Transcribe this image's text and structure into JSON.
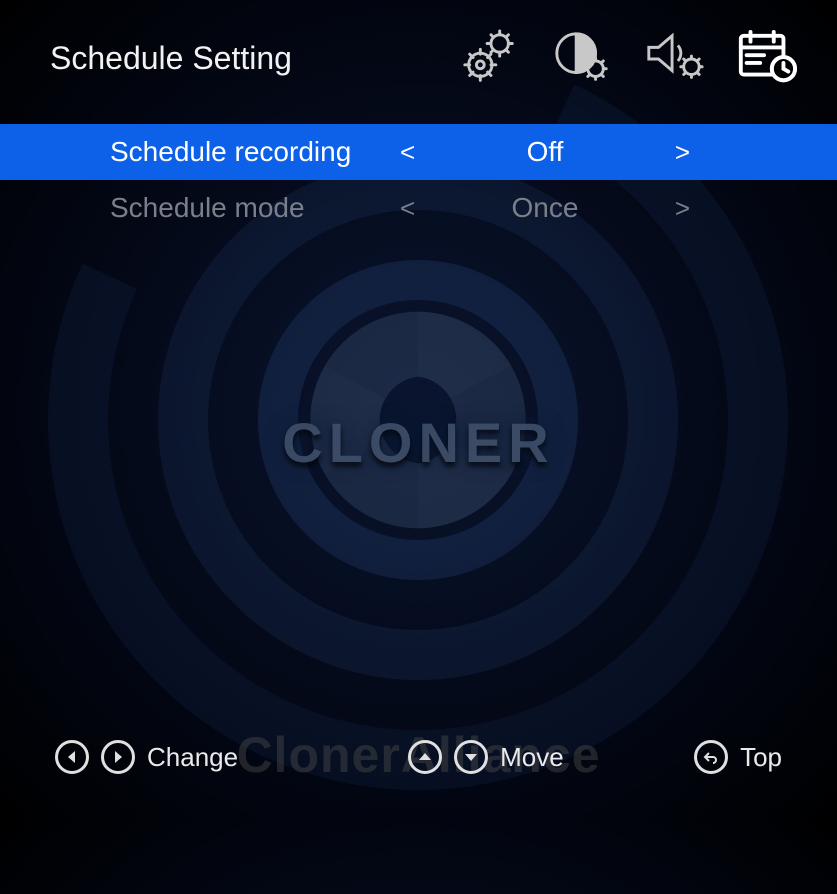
{
  "header": {
    "title": "Schedule Setting",
    "tabs": [
      {
        "id": "general",
        "name": "gears-icon"
      },
      {
        "id": "display",
        "name": "contrast-icon"
      },
      {
        "id": "audio",
        "name": "speaker-settings-icon"
      },
      {
        "id": "schedule",
        "name": "calendar-clock-icon",
        "active": true
      }
    ]
  },
  "menu": {
    "rows": [
      {
        "id": "schedule_recording",
        "label": "Schedule recording",
        "value": "Off",
        "selected": true
      },
      {
        "id": "schedule_mode",
        "label": "Schedule mode",
        "value": "Once",
        "selected": false
      }
    ]
  },
  "hints": {
    "change": "Change",
    "move": "Move",
    "top": "Top"
  },
  "brand": {
    "logo_text": "CLONER",
    "watermark": "ClonerAlliance"
  },
  "colors": {
    "highlight": "#0d60e8",
    "text": "#f2f2f2",
    "dim": "#7a808a"
  }
}
